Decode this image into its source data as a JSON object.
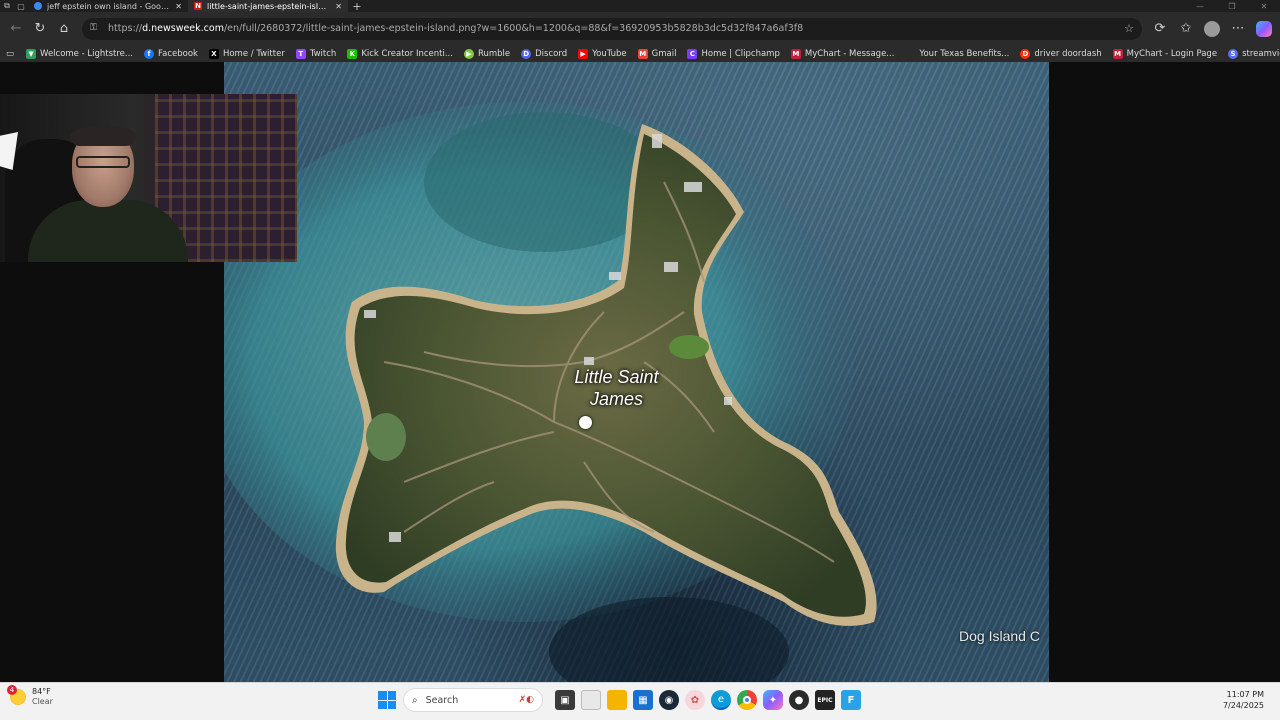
{
  "browser": {
    "tabs": [
      {
        "title": "jeff epstein own island - Google S",
        "favicon_color": "#4285f4",
        "active": false
      },
      {
        "title": "little-saint-james-epstein-island.p",
        "favicon_color": "#d01818",
        "favicon_letter": "N",
        "active": true
      }
    ],
    "new_tab": "+",
    "address": {
      "host": "d.newsweek.com",
      "scheme": "https://",
      "path": "/en/full/2680372/little-saint-james-epstein-island.png?w=1600&h=1200&q=88&f=36920953b5828b3dc5d32f847a6af3f8"
    },
    "bookmarks": [
      {
        "label": "Welcome - Lightstre...",
        "color": "#2e9e5b",
        "glyph": "▼"
      },
      {
        "label": "Facebook",
        "color": "#1877f2",
        "glyph": "f"
      },
      {
        "label": "Home / Twitter",
        "color": "#000000",
        "glyph": "X"
      },
      {
        "label": "Twitch",
        "color": "#9146ff",
        "glyph": "T"
      },
      {
        "label": "Kick Creator Incenti...",
        "color": "#18c000",
        "glyph": "K"
      },
      {
        "label": "Rumble",
        "color": "#85c742",
        "glyph": "▶"
      },
      {
        "label": "Discord",
        "color": "#5865f2",
        "glyph": "D"
      },
      {
        "label": "YouTube",
        "color": "#ff0000",
        "glyph": "▶"
      },
      {
        "label": "Gmail",
        "color": "#ea4335",
        "glyph": "M"
      },
      {
        "label": "Home | Clipchamp",
        "color": "#7a3cff",
        "glyph": "C"
      },
      {
        "label": "MyChart - Message...",
        "color": "#c0203a",
        "glyph": "M"
      },
      {
        "label": "Your Texas Benefits...",
        "color": "#2b2b2b",
        "glyph": ""
      },
      {
        "label": "driver doordash",
        "color": "#ff3008",
        "glyph": "D"
      },
      {
        "label": "MyChart - Login Page",
        "color": "#c0203a",
        "glyph": "M"
      },
      {
        "label": "streamviewersbot p...",
        "color": "#5a6cff",
        "glyph": "S"
      }
    ]
  },
  "map": {
    "island_label_line1": "Little Saint",
    "island_label_line2": "James",
    "neighbor_label": "Dog Island C"
  },
  "taskbar": {
    "weather_temp": "84°F",
    "weather_cond": "Clear",
    "weather_badge": "4",
    "search_placeholder": "Search",
    "time": "11:07 PM",
    "date": "7/24/2025",
    "apps": [
      {
        "name": "task-view",
        "color": "#3a3a3a",
        "glyph": "▣"
      },
      {
        "name": "file",
        "color": "#e8e8e8",
        "glyph": ""
      },
      {
        "name": "file-explorer",
        "color": "#f4b400",
        "glyph": ""
      },
      {
        "name": "store",
        "color": "#1b6fd1",
        "glyph": "▦"
      },
      {
        "name": "steam",
        "color": "#1b2838",
        "glyph": "◉"
      },
      {
        "name": "app-pink",
        "color": "#f7d6dc",
        "glyph": "✿"
      },
      {
        "name": "edge",
        "color": "#0f9bd7",
        "glyph": "e"
      },
      {
        "name": "chrome",
        "color": "#e0e0e0",
        "glyph": "◎"
      },
      {
        "name": "copilot",
        "color": "#7c5cff",
        "glyph": "✦"
      },
      {
        "name": "obs",
        "color": "#2b2b2b",
        "glyph": "●"
      },
      {
        "name": "epic-games",
        "color": "#222222",
        "glyph": "EPIC"
      },
      {
        "name": "fortnite",
        "color": "#2aa3e6",
        "glyph": "F"
      }
    ]
  }
}
